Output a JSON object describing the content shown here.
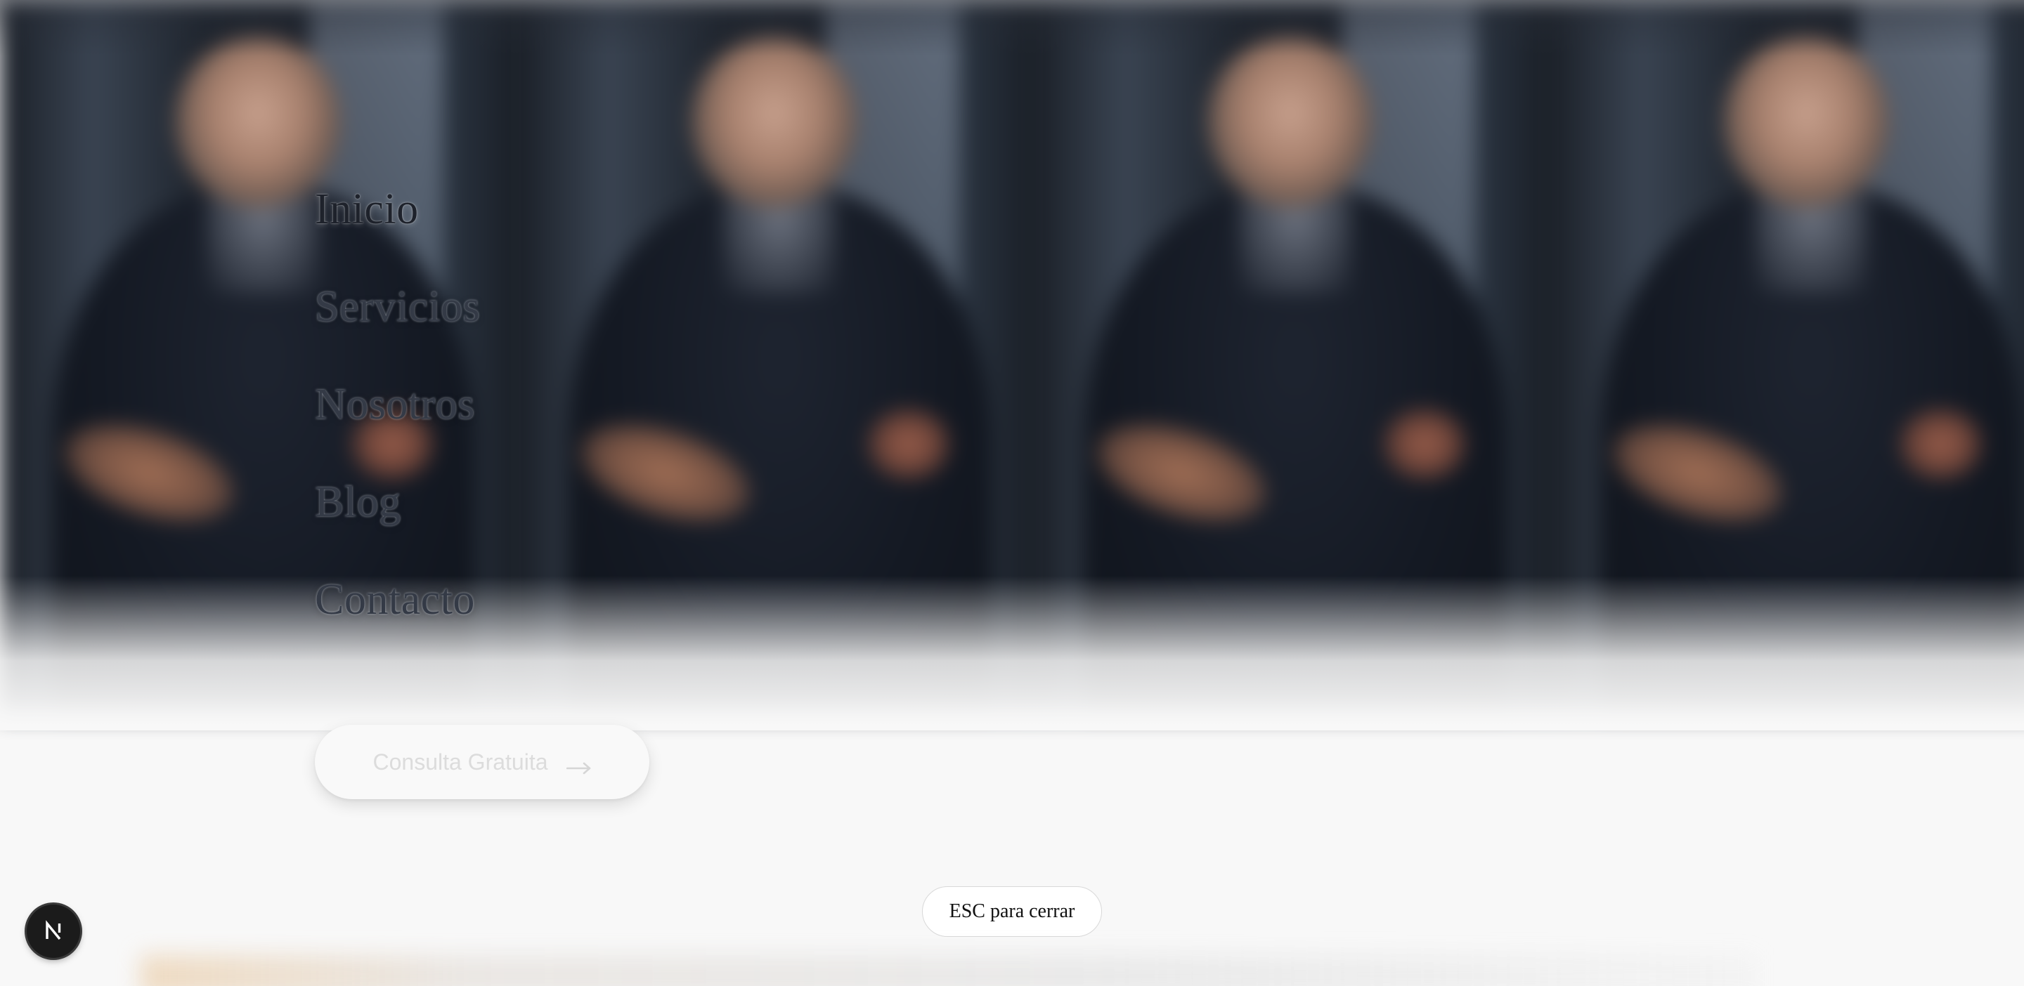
{
  "menu": {
    "items": [
      {
        "label": "Inicio",
        "active": true
      },
      {
        "label": "Servicios",
        "active": false
      },
      {
        "label": "Nosotros",
        "active": false
      },
      {
        "label": "Blog",
        "active": false
      },
      {
        "label": "Contacto",
        "active": false
      }
    ]
  },
  "cta": {
    "label": "Consulta Gratuita",
    "icon": "arrow-right-icon"
  },
  "close_hint": {
    "label": "ESC para cerrar"
  },
  "dev_badge": {
    "letter": "N",
    "icon": "nextjs-logo-icon"
  },
  "colors": {
    "menu_active": "#1e222b",
    "menu_inactive": "#343a46",
    "page_background": "#f8f8f8",
    "badge_background": "#1b1b1b"
  }
}
